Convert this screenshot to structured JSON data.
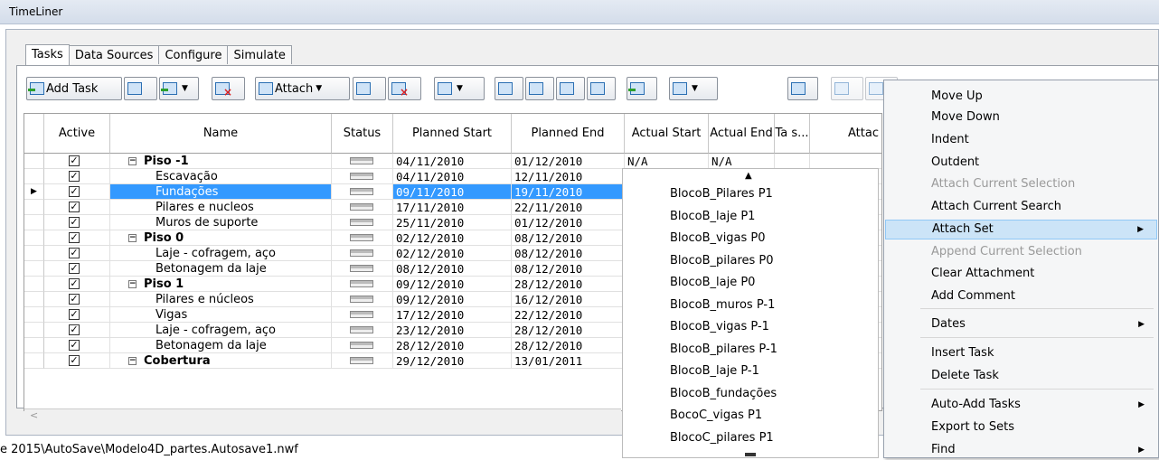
{
  "window": {
    "title": "TimeLiner"
  },
  "tabs": [
    "Tasks",
    "Data Sources",
    "Configure",
    "Simulate"
  ],
  "toolbar": {
    "add_task": "Add Task",
    "attach": "Attach"
  },
  "grid": {
    "columns": [
      "Active",
      "Name",
      "Status",
      "Planned Start",
      "Planned End",
      "Actual Start",
      "Actual End",
      "Ta s...",
      "Attac"
    ],
    "rows": [
      {
        "name": "Piso -1",
        "group": true,
        "start": "04/11/2010",
        "end": "01/12/2010",
        "astart": "N/A",
        "aend": "N/A"
      },
      {
        "name": "Escavação",
        "group": false,
        "start": "04/11/2010",
        "end": "12/11/2010",
        "astart": "",
        "aend": ""
      },
      {
        "name": "Fundações",
        "group": false,
        "start": "09/11/2010",
        "end": "19/11/2010",
        "astart": "",
        "aend": ""
      },
      {
        "name": "Pilares e nucleos",
        "group": false,
        "start": "17/11/2010",
        "end": "22/11/2010",
        "astart": "",
        "aend": ""
      },
      {
        "name": "Muros de suporte",
        "group": false,
        "start": "25/11/2010",
        "end": "01/12/2010",
        "astart": "",
        "aend": ""
      },
      {
        "name": "Piso 0",
        "group": true,
        "start": "02/12/2010",
        "end": "08/12/2010",
        "astart": "",
        "aend": ""
      },
      {
        "name": "Laje - cofragem, aço",
        "group": false,
        "start": "02/12/2010",
        "end": "08/12/2010",
        "astart": "",
        "aend": ""
      },
      {
        "name": "Betonagem da laje",
        "group": false,
        "start": "08/12/2010",
        "end": "08/12/2010",
        "astart": "",
        "aend": ""
      },
      {
        "name": "Piso 1",
        "group": true,
        "start": "09/12/2010",
        "end": "28/12/2010",
        "astart": "",
        "aend": ""
      },
      {
        "name": "Pilares e núcleos",
        "group": false,
        "start": "09/12/2010",
        "end": "16/12/2010",
        "astart": "",
        "aend": ""
      },
      {
        "name": "Vigas",
        "group": false,
        "start": "17/12/2010",
        "end": "22/12/2010",
        "astart": "",
        "aend": ""
      },
      {
        "name": "Laje - cofragem, aço",
        "group": false,
        "start": "23/12/2010",
        "end": "28/12/2010",
        "astart": "",
        "aend": ""
      },
      {
        "name": "Betonagem da laje",
        "group": false,
        "start": "28/12/2010",
        "end": "28/12/2010",
        "astart": "",
        "aend": ""
      },
      {
        "name": "Cobertura",
        "group": true,
        "start": "29/12/2010",
        "end": "13/01/2011",
        "astart": "",
        "aend": ""
      }
    ],
    "selected_index": 2
  },
  "footer_path": "e 2015\\AutoSave\\Modelo4D_partes.Autosave1.nwf",
  "sets_submenu": [
    "BlocoB_Pilares P1",
    "BlocoB_laje P1",
    "BlocoB_vigas P0",
    "BlocoB_pilares P0",
    "BlocoB_laje P0",
    "BlocoB_muros P-1",
    "BlocoB_vigas P-1",
    "BlocoB_pilares P-1",
    "BlocoB_laje P-1",
    "BlocoB_fundações",
    "BocoC_vigas P1",
    "BlocoC_pilares P1"
  ],
  "context_menu": [
    {
      "label": "Move Up",
      "disabled": false,
      "submenu": false
    },
    {
      "label": "Move Down",
      "disabled": false,
      "submenu": false
    },
    {
      "label": "Indent",
      "disabled": false,
      "submenu": false
    },
    {
      "label": "Outdent",
      "disabled": false,
      "submenu": false
    },
    {
      "label": "Attach Current Selection",
      "disabled": true,
      "submenu": false
    },
    {
      "label": "Attach Current Search",
      "disabled": false,
      "submenu": false
    },
    {
      "label": "Attach Set",
      "disabled": false,
      "submenu": true,
      "highlighted": true
    },
    {
      "label": "Append Current Selection",
      "disabled": true,
      "submenu": false
    },
    {
      "label": "Clear Attachment",
      "disabled": false,
      "submenu": false
    },
    {
      "label": "Add Comment",
      "disabled": false,
      "submenu": false
    },
    {
      "label": "Dates",
      "disabled": false,
      "submenu": true
    },
    {
      "label": "Insert Task",
      "disabled": false,
      "submenu": false
    },
    {
      "label": "Delete Task",
      "disabled": false,
      "submenu": false
    },
    {
      "label": "Auto-Add Tasks",
      "disabled": false,
      "submenu": true
    },
    {
      "label": "Export to Sets",
      "disabled": false,
      "submenu": false
    },
    {
      "label": "Find",
      "disabled": false,
      "submenu": true
    }
  ]
}
